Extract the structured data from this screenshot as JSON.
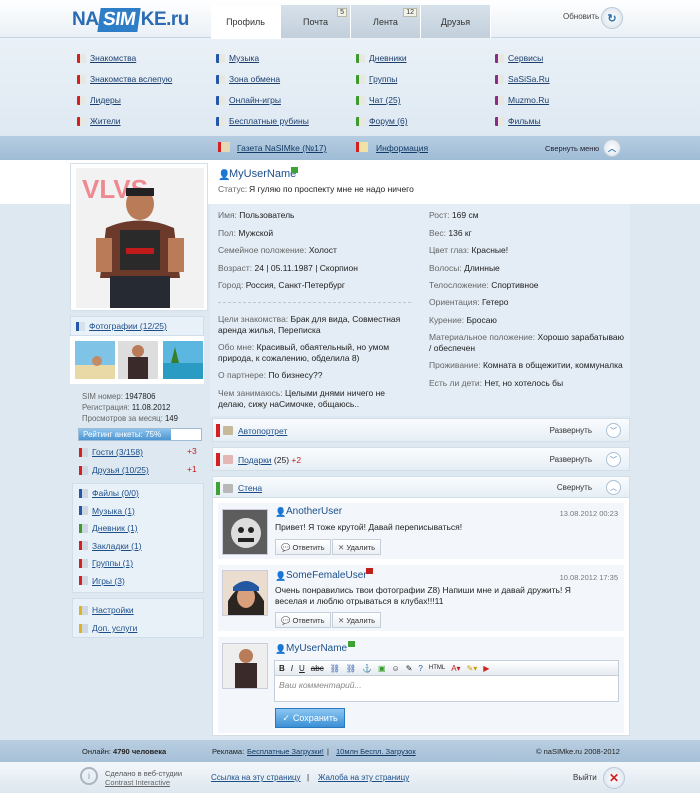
{
  "header": {
    "logo_na": "NA",
    "logo_sim": "SIM",
    "logo_ke": "KE.ru",
    "tabs": [
      {
        "label": "Профиль",
        "badge": ""
      },
      {
        "label": "Почта",
        "badge": "5"
      },
      {
        "label": "Лента",
        "badge": "12"
      },
      {
        "label": "Друзья",
        "badge": ""
      }
    ],
    "refresh_label": "Обновить"
  },
  "menu": [
    {
      "label": "Знакомства",
      "color": "#d42020"
    },
    {
      "label": "Музыка",
      "color": "#2457a8"
    },
    {
      "label": "Дневники",
      "color": "#3c9b2d"
    },
    {
      "label": "Сервисы",
      "color": "#8a2d8a"
    },
    {
      "label": "Знакомства вслепую",
      "color": "#d42020"
    },
    {
      "label": "Зона обмена",
      "color": "#2457a8"
    },
    {
      "label": "Группы",
      "color": "#3c9b2d"
    },
    {
      "label": "SaSiSa.Ru",
      "color": "#8a2d8a"
    },
    {
      "label": "Лидеры",
      "color": "#d42020"
    },
    {
      "label": "Онлайн-игры",
      "color": "#2457a8"
    },
    {
      "label": "Чат (25)",
      "color": "#3c9b2d"
    },
    {
      "label": "Muzmo.Ru",
      "color": "#8a2d8a"
    },
    {
      "label": "Жители",
      "color": "#d42020"
    },
    {
      "label": "Бесплатные рубины",
      "color": "#2457a8"
    },
    {
      "label": "Форум (6)",
      "color": "#3c9b2d"
    },
    {
      "label": "Фильмы",
      "color": "#8a2d8a"
    }
  ],
  "submenu": {
    "gazeta": "Газета NaSIMke (№17)",
    "info": "Информация",
    "collapse": "Свернуть меню"
  },
  "profile": {
    "username": "MyUserName",
    "status_label": "Статус:",
    "status_text": "Я гуляю по проспекту мне не надо ничего",
    "left": [
      {
        "k": "Имя:",
        "v": "Пользователь"
      },
      {
        "k": "Пол:",
        "v": "Мужской"
      },
      {
        "k": "Семейное положение:",
        "v": "Холост"
      },
      {
        "k": "Возраст:",
        "v": "24 | 05.11.1987 | Скорпион"
      },
      {
        "k": "Город:",
        "v": "Россия, Санкт-Петербург"
      }
    ],
    "right": [
      {
        "k": "Рост:",
        "v": "169 см"
      },
      {
        "k": "Вес:",
        "v": "136 кг"
      },
      {
        "k": "Цвет глаз:",
        "v": "Красные!"
      },
      {
        "k": "Волосы:",
        "v": "Длинные"
      },
      {
        "k": "Телосложение:",
        "v": "Спортивное"
      },
      {
        "k": "Ориентация:",
        "v": "Гетеро"
      },
      {
        "k": "Курение:",
        "v": "Бросаю"
      },
      {
        "k": "Материальное положение:",
        "v": "Хорошо зарабатываю / обеспечен"
      },
      {
        "k": "Проживание:",
        "v": "Комната в общежитии, коммуналка"
      },
      {
        "k": "Есть ли дети:",
        "v": "Нет, но хотелось бы"
      }
    ],
    "goals_k": "Цели знакомства:",
    "goals_v": "Брак для вида, Совместная аренда жилья, Переписка",
    "about_k": "Обо мне:",
    "about_v": "Красивый, обаятельный, но умом природа, к сожалению, обделила 8)",
    "partner_k": "О партнере:",
    "partner_v": "По бизнесу??",
    "hobby_k": "Чем занимаюсь:",
    "hobby_v": "Целыми днями ничего не делаю, сижу наСимочке, общаюсь.."
  },
  "sidebar": {
    "photos": "Фотографии (12/25)",
    "sim_k": "SIM номер:",
    "sim_v": "1947806",
    "reg_k": "Регистрация:",
    "reg_v": "11.08.2012",
    "views_k": "Просмотров за месяц:",
    "views_v": "149",
    "rating": "Рейтинг анкеты: 75%",
    "rating_value": 0.75,
    "guests": "Гости (3/158)",
    "guests_delta": "+3",
    "friends": "Друзья (10/25)",
    "friends_delta": "+1",
    "items": [
      "Файлы (0/0)",
      "Музыка (1)",
      "Дневник (1)",
      "Закладки (1)",
      "Группы (1)",
      "Игры (3)"
    ],
    "settings": "Настройки",
    "services": "Доп. услуги"
  },
  "sections": {
    "autoportret": "Автопортрет",
    "autoportret_act": "Развернуть",
    "gifts": "Подарки",
    "gifts_count": "(25)",
    "gifts_delta": "+2",
    "gifts_act": "Развернуть",
    "wall": "Стена",
    "wall_act": "Свернуть"
  },
  "wall": {
    "posts": [
      {
        "user": "AnotherUser",
        "date": "13.08.2012 00:23",
        "text": "Привет! Я тоже крутой! Давай переписываться!"
      },
      {
        "user": "SomeFemaleUser",
        "date": "10.08.2012 17:35",
        "text": "Очень понравились твои фотографии Z8) Напиши мне и давай дружить! Я веселая и люблю отрываться в клубах!!!11"
      }
    ],
    "reply": "Ответить",
    "delete": "Удалить",
    "composer_user": "MyUserName",
    "placeholder": "Ваш комментарий...",
    "save": "Сохранить"
  },
  "footer": {
    "online_label": "Онлайн:",
    "online_value": "4790 человека",
    "ads_label": "Реклама:",
    "ad1": "Бесплатные Загрузки!",
    "ad2": "10млн Беспл. Загрузок",
    "copyright": "© naSIMke.ru 2008-2012",
    "made1": "Сделано в веб-студии",
    "made2": "Contrast Interactive",
    "link": "Ссылка на эту страницу",
    "complaint": "Жалоба на эту страницу",
    "exit": "Выйти"
  }
}
